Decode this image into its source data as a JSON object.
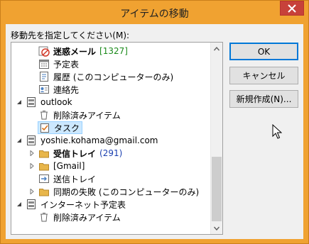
{
  "window": {
    "title": "アイテムの移動"
  },
  "prompt": "移動先を指定してください(M):",
  "tree": [
    {
      "label": "迷惑メール",
      "count": "[1327]",
      "count_style": "green",
      "bold": true,
      "icon": "junk-mail-icon"
    },
    {
      "label": "予定表",
      "icon": "calendar-icon"
    },
    {
      "label": "履歴 (このコンピューターのみ)",
      "icon": "history-icon"
    },
    {
      "label": "連絡先",
      "icon": "contacts-icon"
    },
    {
      "label": "outlook",
      "icon": "mailbox-icon",
      "expanded": true
    },
    {
      "label": "削除済みアイテム",
      "icon": "trash-icon"
    },
    {
      "label": "タスク",
      "icon": "tasks-icon",
      "selected": true
    },
    {
      "label": "yoshie.kohama@gmail.com",
      "icon": "mailbox-icon",
      "expanded": true
    },
    {
      "label": "受信トレイ",
      "count": "(291)",
      "count_style": "blue",
      "bold": true,
      "icon": "inbox-icon",
      "collapsed": true
    },
    {
      "label": "[Gmail]",
      "icon": "folder-icon",
      "collapsed": true
    },
    {
      "label": "送信トレイ",
      "icon": "outbox-icon"
    },
    {
      "label": "同期の失敗 (このコンピューターのみ)",
      "icon": "sync-failure-icon",
      "collapsed": true
    },
    {
      "label": "インターネット予定表",
      "icon": "mailbox-icon",
      "expanded": true
    },
    {
      "label": "削除済みアイテム",
      "icon": "trash-icon"
    }
  ],
  "buttons": {
    "ok": "OK",
    "cancel": "キャンセル",
    "new": "新規作成(N)..."
  }
}
